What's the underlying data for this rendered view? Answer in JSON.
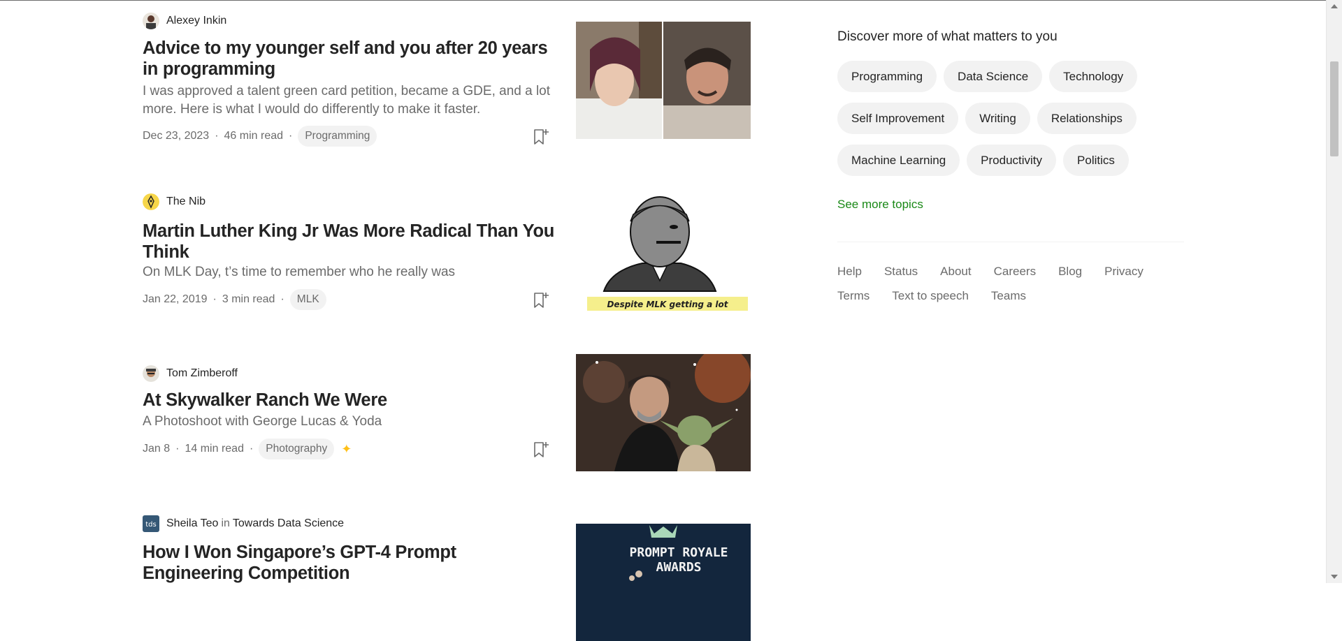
{
  "articles": [
    {
      "author": "Alexey Inkin",
      "title": "Advice to my younger self and you after 20 years in programming",
      "subtitle": "I was approved a talent green card petition, became a GDE, and a lot more. Here is what I would do differently to make it faster.",
      "date": "Dec 23, 2023",
      "read_time": "46 min read",
      "tag": "Programming"
    },
    {
      "author": "The Nib",
      "title": "Martin Luther King Jr Was More Radical Than You Think",
      "subtitle": "On MLK Day, t’s time to remember who he really was",
      "date": "Jan 22, 2019",
      "read_time": "3 min read",
      "tag": "MLK",
      "image_caption": "Despite MLK getting a lot"
    },
    {
      "author": "Tom Zimberoff",
      "title": "At Skywalker Ranch We Were",
      "subtitle": "A Photoshoot with George Lucas & Yoda",
      "date": "Jan 8",
      "read_time": "14 min read",
      "tag": "Photography",
      "member_icon": "star-sparkle-icon"
    },
    {
      "author": "Sheila Teo",
      "in_word": "in",
      "publication": "Towards Data Science",
      "publication_logo": "tds",
      "title": "How I Won Singapore’s GPT-4 Prompt Engineering Competition",
      "image_text_1": "PROMPT ROYALE",
      "image_text_2": "AWARDS"
    }
  ],
  "sidebar": {
    "heading": "Discover more of what matters to you",
    "topic_rows": [
      [
        "Programming",
        "Data Science",
        "Technology"
      ],
      [
        "Self Improvement",
        "Writing",
        "Relationships"
      ],
      [
        "Machine Learning",
        "Productivity",
        "Politics"
      ]
    ],
    "see_more": "See more topics",
    "footer_links": [
      "Help",
      "Status",
      "About",
      "Careers",
      "Blog",
      "Privacy",
      "Terms",
      "Text to speech",
      "Teams"
    ]
  },
  "colors": {
    "text": "#242424",
    "muted": "#6b6b6b",
    "chip_bg": "#f2f2f2",
    "accent_green": "#1a8917",
    "member_star": "#ffc017"
  }
}
